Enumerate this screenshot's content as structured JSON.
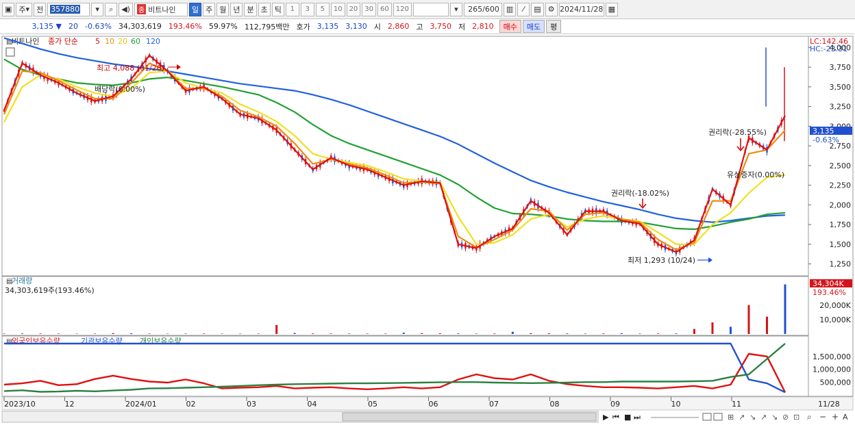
{
  "toolbar": {
    "market_label": "주",
    "prev_label": "전",
    "stock_code": "357880",
    "stock_name": "비트나인",
    "stock_badge": "종",
    "periods": [
      "일",
      "주",
      "월",
      "년",
      "분",
      "초",
      "틱"
    ],
    "selected_period": "일",
    "intervals": [
      "1",
      "3",
      "5",
      "10",
      "20",
      "30",
      "60",
      "120"
    ],
    "count_display": "265",
    "count_max": "/600",
    "date": "2024/11/28"
  },
  "quote": {
    "price": "3,135",
    "change": "20",
    "change_pct": "-0.63%",
    "volume": "34,303,619",
    "volume_ratio": "193.46%",
    "turnover": "59.97%",
    "amount": "112,795백만",
    "bid_label": "호가",
    "bid": "3,135",
    "ask": "3,130",
    "open_label": "시",
    "open": "2,860",
    "high_label": "고",
    "high": "3,750",
    "low_label": "저",
    "low": "2,810",
    "buy_label": "매수",
    "sell_label": "매도",
    "eval_label": "평"
  },
  "price_panel": {
    "title": "비트나인",
    "ma_label": "종가 단순",
    "ma_periods": [
      {
        "period": "5",
        "color": "#e01010"
      },
      {
        "period": "10",
        "color": "#f08a10"
      },
      {
        "period": "20",
        "color": "#f0e020"
      },
      {
        "period": "60",
        "color": "#20a030"
      },
      {
        "period": "120",
        "color": "#2060e0"
      }
    ],
    "lc_label": "LC:142.46",
    "hc_label": "HC:-23.31",
    "current_price_tag": "3,135",
    "current_change_tag": "-0.63%",
    "annotations": {
      "high": "최고 4,088 (01/26)",
      "dividend": "배당락(0.00%)",
      "rights1": "권리락(-18.02%)",
      "low": "최저 1,293 (10/24)",
      "rights2": "권리락(-28.55%)",
      "capital_increase": "유상증자(0.00%)"
    }
  },
  "volume_panel": {
    "title": "거래량",
    "value_label": "34,303,619주(193.46%)",
    "tag_value": "34,304K",
    "tag_pct": "193.46%"
  },
  "holdings_panel": {
    "legend": [
      "외국인보유수량",
      "기관보유수량",
      "개인보유수량"
    ]
  },
  "x_axis": {
    "labels": [
      "2023/10",
      "12",
      "2024/01",
      "02",
      "03",
      "04",
      "05",
      "06",
      "07",
      "08",
      "09",
      "10",
      "11"
    ],
    "end_label": "11/28"
  },
  "chart_data": [
    {
      "type": "line",
      "name": "price",
      "x_range": [
        "2023/10",
        "2024/11/28"
      ],
      "ylim": [
        1125,
        4125
      ],
      "y_ticks": [
        "4,000",
        "3,750",
        "3,500",
        "3,250",
        "3,000",
        "2,750",
        "2,500",
        "2,250",
        "2,000",
        "1,750",
        "1,500",
        "1,250"
      ],
      "y_values": [
        4000,
        3750,
        3500,
        3250,
        3000,
        2750,
        2500,
        2250,
        2000,
        1750,
        1500,
        1250
      ],
      "series": [
        {
          "name": "5",
          "color": "#e01010",
          "values": [
            3200,
            3800,
            3650,
            3550,
            3420,
            3320,
            3380,
            3600,
            3900,
            3700,
            3450,
            3500,
            3350,
            3150,
            3100,
            2950,
            2700,
            2450,
            2600,
            2500,
            2450,
            2350,
            2250,
            2300,
            2280,
            1500,
            1450,
            1600,
            1700,
            2050,
            1900,
            1620,
            1920,
            1920,
            1800,
            1760,
            1500,
            1400,
            1550,
            2200,
            2000,
            2850,
            2700,
            3135
          ]
        },
        {
          "name": "10",
          "color": "#f08a10",
          "values": [
            3150,
            3700,
            3680,
            3580,
            3460,
            3350,
            3350,
            3550,
            3800,
            3700,
            3480,
            3480,
            3380,
            3200,
            3120,
            3000,
            2780,
            2520,
            2580,
            2520,
            2470,
            2380,
            2280,
            2290,
            2270,
            1600,
            1460,
            1560,
            1680,
            1950,
            1920,
            1680,
            1880,
            1900,
            1820,
            1780,
            1560,
            1430,
            1520,
            2050,
            2050,
            2650,
            2700,
            2950
          ]
        },
        {
          "name": "20",
          "color": "#f0e020",
          "values": [
            3050,
            3500,
            3650,
            3600,
            3500,
            3420,
            3380,
            3480,
            3680,
            3700,
            3550,
            3480,
            3420,
            3280,
            3180,
            3060,
            2880,
            2650,
            2580,
            2540,
            2500,
            2420,
            2330,
            2300,
            2290,
            1850,
            1500,
            1520,
            1620,
            1820,
            1880,
            1720,
            1820,
            1860,
            1820,
            1790,
            1650,
            1500,
            1500,
            1750,
            1900,
            2150,
            2350,
            2380
          ]
        },
        {
          "name": "60",
          "color": "#20a030",
          "values": [
            3850,
            3720,
            3650,
            3600,
            3550,
            3530,
            3520,
            3550,
            3600,
            3620,
            3580,
            3540,
            3500,
            3450,
            3400,
            3300,
            3180,
            3020,
            2880,
            2780,
            2700,
            2620,
            2540,
            2460,
            2380,
            2260,
            2100,
            1960,
            1890,
            1880,
            1860,
            1820,
            1800,
            1790,
            1790,
            1780,
            1740,
            1700,
            1690,
            1730,
            1780,
            1820,
            1880,
            1900
          ]
        },
        {
          "name": "120",
          "color": "#2060e0",
          "values": [
            4120,
            4050,
            3980,
            3920,
            3870,
            3830,
            3790,
            3760,
            3730,
            3700,
            3660,
            3620,
            3580,
            3540,
            3510,
            3480,
            3450,
            3400,
            3340,
            3270,
            3190,
            3110,
            3030,
            2950,
            2870,
            2770,
            2650,
            2530,
            2420,
            2310,
            2230,
            2160,
            2100,
            2040,
            1990,
            1940,
            1880,
            1830,
            1800,
            1780,
            1800,
            1830,
            1860,
            1870
          ]
        }
      ]
    },
    {
      "type": "bar",
      "name": "volume",
      "y_ticks": [
        "20,000K",
        "10,000K"
      ],
      "y_values": [
        20000,
        10000
      ],
      "ylim": [
        0,
        36000
      ],
      "values": [
        300,
        400,
        350,
        300,
        250,
        300,
        600,
        500,
        300,
        250,
        300,
        350,
        250,
        250,
        300,
        6200,
        700,
        400,
        350,
        350,
        300,
        300,
        900,
        600,
        500,
        400,
        300,
        350,
        1500,
        600,
        500,
        400,
        300,
        400,
        500,
        300,
        350,
        400,
        3500,
        8000,
        5000,
        20000,
        12000,
        34304
      ]
    },
    {
      "type": "line",
      "name": "holdings",
      "y_ticks": [
        "1,500,000",
        "1,000,000",
        "500,000"
      ],
      "y_values": [
        1500000,
        1000000,
        500000
      ],
      "ylim": [
        0,
        2000000
      ],
      "series": [
        {
          "name": "외국인보유수량",
          "color": "#e01010",
          "values": [
            400000,
            450000,
            550000,
            380000,
            420000,
            620000,
            750000,
            620000,
            520000,
            480000,
            600000,
            450000,
            250000,
            280000,
            300000,
            350000,
            250000,
            280000,
            300000,
            250000,
            220000,
            250000,
            300000,
            250000,
            300000,
            600000,
            800000,
            650000,
            600000,
            800000,
            550000,
            420000,
            350000,
            300000,
            300000,
            280000,
            250000,
            300000,
            350000,
            250000,
            400000,
            1600000,
            1500000,
            100000
          ]
        },
        {
          "name": "기관보유수량",
          "color": "#2050d0",
          "values": [
            2000000,
            2000000,
            2000000,
            2000000,
            2000000,
            2000000,
            2000000,
            2000000,
            2000000,
            2000000,
            2000000,
            2000000,
            2000000,
            2000000,
            2000000,
            2000000,
            2000000,
            2000000,
            2000000,
            2000000,
            2000000,
            2000000,
            2000000,
            2000000,
            2000000,
            2000000,
            2000000,
            2000000,
            2000000,
            2000000,
            2000000,
            2000000,
            2000000,
            2000000,
            2000000,
            2000000,
            2000000,
            2000000,
            2000000,
            2000000,
            2000000,
            600000,
            450000,
            100000
          ]
        },
        {
          "name": "개인보유수량",
          "color": "#2a8040",
          "values": [
            150000,
            180000,
            120000,
            130000,
            160000,
            140000,
            170000,
            200000,
            250000,
            260000,
            280000,
            300000,
            320000,
            350000,
            380000,
            400000,
            420000,
            430000,
            440000,
            450000,
            450000,
            460000,
            470000,
            480000,
            490000,
            500000,
            500000,
            480000,
            470000,
            460000,
            470000,
            480000,
            500000,
            500000,
            520000,
            520000,
            520000,
            520000,
            530000,
            550000,
            700000,
            800000,
            1400000,
            2000000
          ]
        }
      ]
    }
  ]
}
